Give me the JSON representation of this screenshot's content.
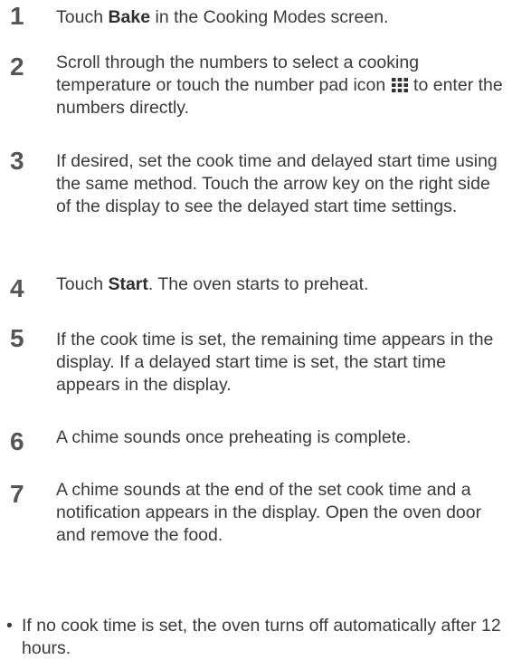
{
  "steps": [
    {
      "number": "1",
      "text_pre": "Touch ",
      "bold": "Bake",
      "text_post": " in the Cooking Modes screen."
    },
    {
      "number": "2",
      "text_pre": "Scroll through the numbers to select a cooking temperature or touch the number pad icon ",
      "icon": "number-pad-icon",
      "text_post": " to enter the numbers directly."
    },
    {
      "number": "3",
      "text": "If desired, set the cook time and delayed start time using the same method. Touch the arrow key on the right side of the display to see the delayed start time settings."
    },
    {
      "number": "4",
      "text_pre": "Touch ",
      "bold": "Start",
      "text_post": ". The oven starts to preheat."
    },
    {
      "number": "5",
      "text": "If the cook time is set, the remaining time appears in the display. If a delayed start time is set, the start time appears in the display."
    },
    {
      "number": "6",
      "text": "A chime sounds once preheating is complete."
    },
    {
      "number": "7",
      "text": "A chime sounds at the end of the set cook time and a notification appears in the display. Open the oven door and remove the food."
    }
  ],
  "note": {
    "bullet": "•",
    "text": "If no cook time is set, the oven turns off automatically after 12 hours."
  },
  "colors": {
    "text": "#3a3a3a",
    "step_number": "#555555",
    "icon": "#333333"
  }
}
